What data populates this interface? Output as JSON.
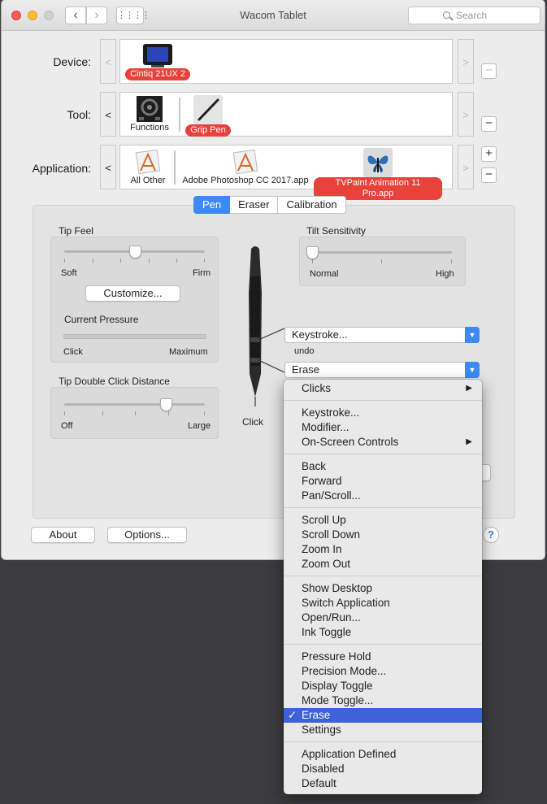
{
  "window": {
    "title": "Wacom Tablet",
    "search_placeholder": "Search",
    "nav_back": "‹",
    "nav_forward": "›",
    "grid": "⋮⋮⋮⋮"
  },
  "rows": {
    "device": {
      "label": "Device:",
      "items": [
        {
          "label": "Cintiq 21UX 2",
          "selected": true
        }
      ]
    },
    "tool": {
      "label": "Tool:",
      "items": [
        {
          "label": "Functions",
          "selected": false
        },
        {
          "label": "Grip Pen",
          "selected": true
        }
      ]
    },
    "application": {
      "label": "Application:",
      "items": [
        {
          "label": "All Other",
          "selected": false
        },
        {
          "label": "Adobe Photoshop CC 2017.app",
          "selected": false
        },
        {
          "label": "TVPaint Animation 11 Pro.app",
          "selected": true
        }
      ]
    },
    "arrow_left": "<",
    "arrow_right": ">",
    "plus": "+",
    "minus": "−"
  },
  "tabs": [
    {
      "label": "Pen",
      "selected": true
    },
    {
      "label": "Eraser",
      "selected": false
    },
    {
      "label": "Calibration",
      "selected": false
    }
  ],
  "tip_feel": {
    "label": "Tip Feel",
    "min_label": "Soft",
    "max_label": "Firm",
    "value_fraction": 0.5,
    "customize_label": "Customize...",
    "current_pressure_label": "Current Pressure",
    "pressure_min_label": "Click",
    "pressure_max_label": "Maximum",
    "pressure_value_fraction": 0.0
  },
  "double_click": {
    "label": "Tip Double Click Distance",
    "min_label": "Off",
    "max_label": "Large",
    "value_fraction": 0.72
  },
  "tilt": {
    "label": "Tilt Sensitivity",
    "min_label": "Normal",
    "max_label": "High",
    "value_fraction": 0.0
  },
  "pen": {
    "tip_label": "Click",
    "upper_button_value": "Keystroke...",
    "upper_button_note": "undo",
    "lower_button_value": "Erase"
  },
  "bottom": {
    "about_label": "About",
    "options_label": "Options...",
    "help_label": "?"
  },
  "menu": {
    "groups": [
      [
        {
          "label": "Clicks",
          "submenu": true
        }
      ],
      [
        {
          "label": "Keystroke..."
        },
        {
          "label": "Modifier..."
        },
        {
          "label": "On-Screen Controls",
          "submenu": true
        }
      ],
      [
        {
          "label": "Back"
        },
        {
          "label": "Forward"
        },
        {
          "label": "Pan/Scroll..."
        }
      ],
      [
        {
          "label": "Scroll Up"
        },
        {
          "label": "Scroll Down"
        },
        {
          "label": "Zoom In"
        },
        {
          "label": "Zoom Out"
        }
      ],
      [
        {
          "label": "Show Desktop"
        },
        {
          "label": "Switch Application"
        },
        {
          "label": "Open/Run..."
        },
        {
          "label": "Ink Toggle"
        }
      ],
      [
        {
          "label": "Pressure Hold"
        },
        {
          "label": "Precision Mode..."
        },
        {
          "label": "Display Toggle"
        },
        {
          "label": "Mode Toggle..."
        },
        {
          "label": "Erase",
          "selected": true
        },
        {
          "label": "Settings"
        }
      ],
      [
        {
          "label": "Application Defined"
        },
        {
          "label": "Disabled"
        },
        {
          "label": "Default"
        }
      ]
    ],
    "check_glyph": "✓",
    "submenu_glyph": "▶"
  },
  "colors": {
    "accent": "#3d8af7",
    "selection_pill": "#e8423a",
    "menu_highlight": "#3e61d9"
  }
}
